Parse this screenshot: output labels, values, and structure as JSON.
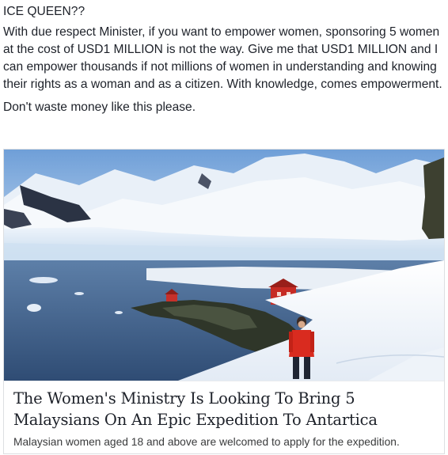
{
  "post": {
    "headline": "ICE QUEEN??",
    "paragraph1": "With due respect Minister, if you want to empower women, sponsoring 5 women at the cost of USD1 MILLION is not the way. Give me that USD1 MILLION and I can empower thousands if not millions of women in understanding and knowing their rights as a woman and as a citizen. With knowledge, comes empowerment.",
    "paragraph2": "Don't waste money like this please."
  },
  "link_preview": {
    "title": "The Women's Ministry Is Looking To Bring 5 Malaysians On An Epic Expedition To Antartica",
    "description": "Malaysian women aged 18 and above are welcomed to apply for the expedition."
  },
  "colors": {
    "text": "#1d2129",
    "card_border": "#dddfe2",
    "jacket_red": "#d92b1f"
  }
}
